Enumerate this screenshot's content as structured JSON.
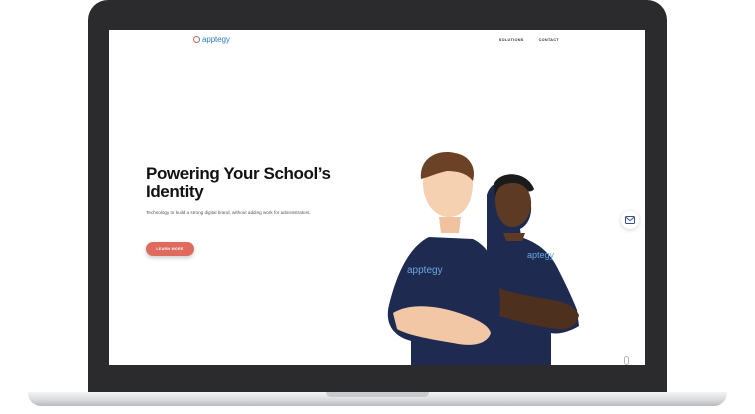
{
  "brand": {
    "name": "apptegy",
    "primary_color": "#2f7fc2",
    "accent_color": "#de6b5e"
  },
  "nav": {
    "items": [
      {
        "label": "SOLUTIONS"
      },
      {
        "label": "CONTACT"
      }
    ]
  },
  "hero": {
    "title": "Powering Your School’s Identity",
    "subtitle": "Technology to build a strong digital brand, without adding work for administrators.",
    "cta_label": "LEARN MORE",
    "shirt_logo_left": "apptegy",
    "shirt_logo_right": "aptegy"
  },
  "icons": {
    "chat": "envelope-icon",
    "scroll": "scroll-mouse-icon"
  }
}
